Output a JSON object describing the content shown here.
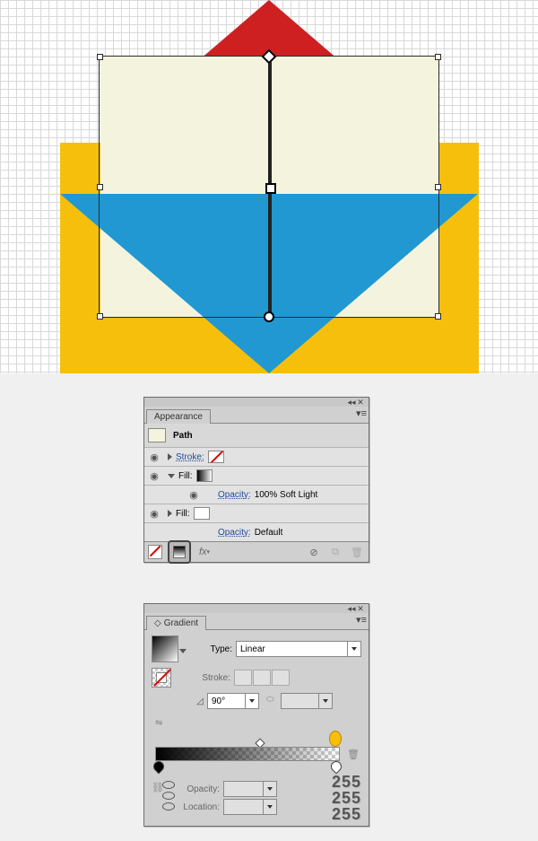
{
  "appearance": {
    "tab": "Appearance",
    "object_type": "Path",
    "rows": {
      "stroke_label": "Stroke:",
      "fill_label": "Fill:",
      "opacity1_label": "Opacity:",
      "opacity1_value": "100% Soft Light",
      "opacity2_label": "Opacity:",
      "opacity2_value": "Default"
    },
    "footer_fx": "fx"
  },
  "gradient": {
    "tab": "Gradient",
    "type_label": "Type:",
    "type_value": "Linear",
    "stroke_label": "Stroke:",
    "angle_value": "90°",
    "opacity_label": "Opacity:",
    "location_label": "Location:",
    "readout": {
      "r": "255",
      "g": "255",
      "b": "255"
    }
  }
}
